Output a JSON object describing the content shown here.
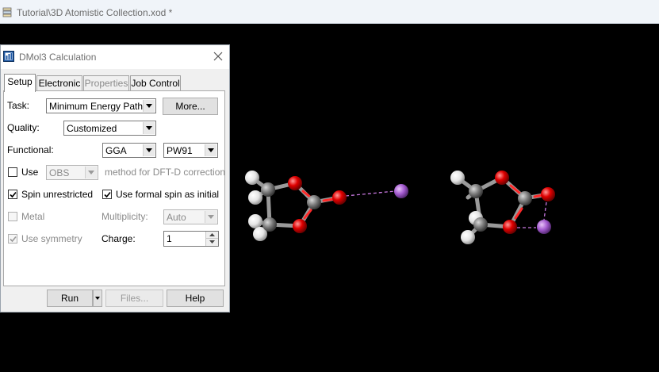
{
  "window": {
    "title": "Tutorial\\3D Atomistic Collection.xod *"
  },
  "dialog": {
    "title": "DMol3 Calculation",
    "tabs": [
      {
        "label": "Setup",
        "active": true,
        "enabled": true
      },
      {
        "label": "Electronic",
        "active": false,
        "enabled": true
      },
      {
        "label": "Properties",
        "active": false,
        "enabled": false
      },
      {
        "label": "Job Control",
        "active": false,
        "enabled": true
      }
    ],
    "setup": {
      "task_label": "Task:",
      "task_value": "Minimum Energy Path",
      "more_button": "More...",
      "quality_label": "Quality:",
      "quality_value": "Customized",
      "functional_label": "Functional:",
      "functional_type": "GGA",
      "functional_name": "PW91",
      "use_label": "Use",
      "use_checked": false,
      "dftd_value": "OBS",
      "dftd_suffix": "method for DFT-D correction",
      "spin_unrestricted_label": "Spin unrestricted",
      "spin_unrestricted_checked": true,
      "formal_spin_label": "Use formal spin as initial",
      "formal_spin_checked": true,
      "metal_label": "Metal",
      "metal_checked": false,
      "multiplicity_label": "Multiplicity:",
      "multiplicity_value": "Auto",
      "use_symmetry_label": "Use symmetry",
      "use_symmetry_checked": true,
      "charge_label": "Charge:",
      "charge_value": "1"
    },
    "buttons": {
      "run": "Run",
      "files": "Files...",
      "help": "Help"
    }
  },
  "colors": {
    "viewport_background": "#000000",
    "carbon": "#8a8a8a",
    "oxygen": "#ff0d0d",
    "hydrogen": "#f2f2f2",
    "lithium": "#b06ad9",
    "hbond_dash": "#c878e0"
  },
  "icons": {
    "window": "document-stack-icon",
    "dialog": "dmol3-app-icon",
    "close": "close-icon"
  }
}
